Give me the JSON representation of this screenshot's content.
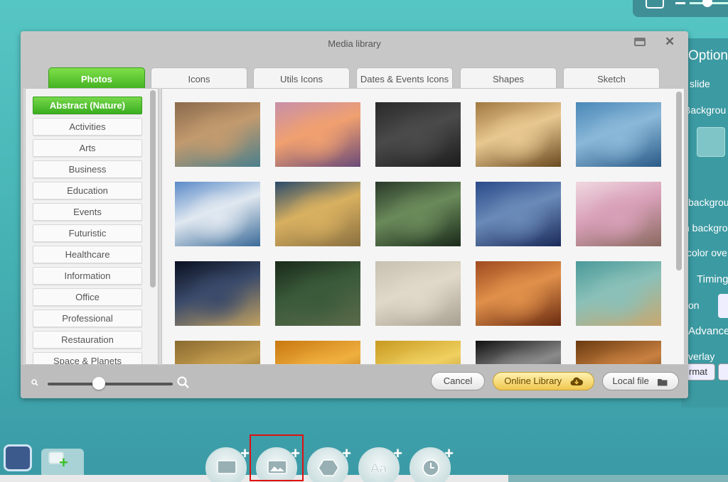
{
  "dialog": {
    "title": "Media library",
    "tabs": [
      "Photos",
      "Icons",
      "Utils Icons",
      "Dates & Events Icons",
      "Shapes",
      "Sketch"
    ],
    "active_tab": "Photos",
    "categories": [
      "Abstract (Nature)",
      "Activities",
      "Arts",
      "Business",
      "Education",
      "Events",
      "Futuristic",
      "Healthcare",
      "Information",
      "Office",
      "Professional",
      "Restauration",
      "Space & Planets"
    ],
    "active_category": "Abstract (Nature)",
    "buttons": {
      "cancel": "Cancel",
      "online_library": "Online Library",
      "local_file": "Local file"
    }
  },
  "thumbnails": [
    {
      "name": "canyon-river-bend",
      "colors": [
        "#8a6a4c",
        "#c29a6e",
        "#4a7f8c"
      ]
    },
    {
      "name": "lake-island-sunset",
      "colors": [
        "#c890a8",
        "#f0a070",
        "#6a4a78"
      ]
    },
    {
      "name": "dark-rain-forest",
      "colors": [
        "#2a2a2a",
        "#4a4a4a",
        "#1c1c1c"
      ]
    },
    {
      "name": "light-streaks",
      "colors": [
        "#a07840",
        "#e8c890",
        "#6a4a20"
      ]
    },
    {
      "name": "blue-ice-crystals",
      "colors": [
        "#4a88b8",
        "#8ab8d8",
        "#2a5a88"
      ]
    },
    {
      "name": "mountain-lake",
      "colors": [
        "#5a8ac8",
        "#e0e8f0",
        "#3a6a98"
      ]
    },
    {
      "name": "sunrise-mist-field",
      "colors": [
        "#2a4a6a",
        "#d8b060",
        "#8a7040"
      ]
    },
    {
      "name": "green-leaf-drops",
      "colors": [
        "#2a3a2a",
        "#6a8a5a",
        "#1a2a1a"
      ]
    },
    {
      "name": "blue-mountain-layers",
      "colors": [
        "#2a4a8a",
        "#6a8ab8",
        "#1a2a5a"
      ]
    },
    {
      "name": "cherry-blossom",
      "colors": [
        "#f0d8e0",
        "#d8a0b8",
        "#8a6a60"
      ]
    },
    {
      "name": "earth-night-lights",
      "colors": [
        "#0a1020",
        "#3a4a6a",
        "#c0a060"
      ]
    },
    {
      "name": "green-cliff-forest",
      "colors": [
        "#1a2a1a",
        "#3a5a3a",
        "#5a6a4a"
      ]
    },
    {
      "name": "sand-ripples",
      "colors": [
        "#c8c0b0",
        "#e0d8c8",
        "#a8a090"
      ]
    },
    {
      "name": "red-rock-waves",
      "colors": [
        "#a04a20",
        "#e0904a",
        "#6a2a10"
      ]
    },
    {
      "name": "aerial-coast",
      "colors": [
        "#4a9a9a",
        "#8ac0b8",
        "#c8a870"
      ]
    },
    {
      "name": "golden-field",
      "colors": [
        "#8a6a30",
        "#c8a050",
        "#5a4a20"
      ]
    },
    {
      "name": "orange-glow",
      "colors": [
        "#c87810",
        "#f0b040",
        "#8a4a08"
      ]
    },
    {
      "name": "yellow-flowers",
      "colors": [
        "#c89a20",
        "#f0d060",
        "#8a6a10"
      ]
    },
    {
      "name": "dark-water-drops",
      "colors": [
        "#101010",
        "#8a8a8a",
        "#2a2a2a"
      ]
    },
    {
      "name": "autumn-leaves",
      "colors": [
        "#6a3a10",
        "#c88040",
        "#3a2a10"
      ]
    }
  ],
  "options_panel": {
    "title": "Option",
    "items": [
      "slide",
      "Backgrou",
      "backgrou",
      "n backgrou",
      "color ove",
      "Timing",
      "on",
      "Advance",
      "verlay"
    ],
    "format_button": "rmat"
  },
  "dock": {
    "buttons": [
      "add-text-box",
      "add-image",
      "add-shape",
      "add-text",
      "add-timer"
    ]
  },
  "colors": {
    "accent_green": "#4ec02a",
    "online_library": "#f0c750",
    "highlight": "#e01010"
  }
}
